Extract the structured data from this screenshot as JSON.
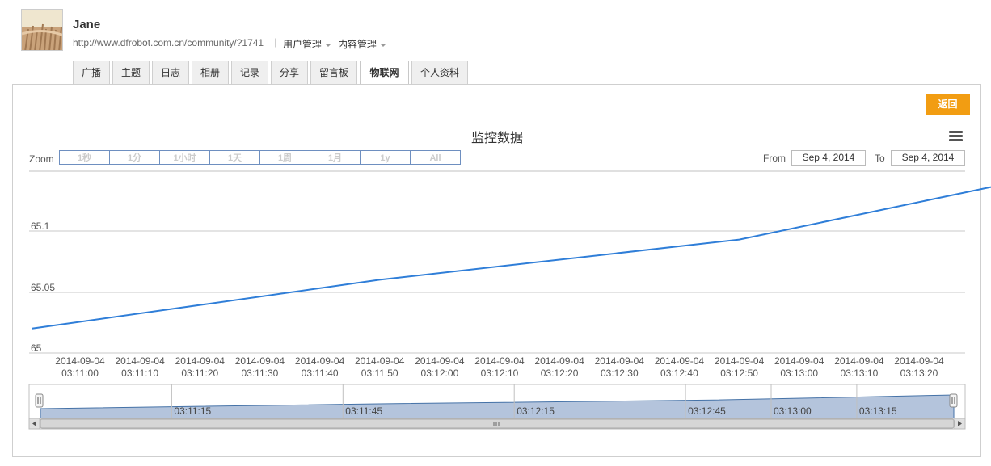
{
  "profile": {
    "name": "Jane",
    "url": "http://www.dfrobot.com.cn/community/?1741",
    "separator": "|",
    "menus": [
      "用户管理",
      "内容管理"
    ]
  },
  "tabs": [
    {
      "label": "广播",
      "active": false
    },
    {
      "label": "主题",
      "active": false
    },
    {
      "label": "日志",
      "active": false
    },
    {
      "label": "相册",
      "active": false
    },
    {
      "label": "记录",
      "active": false
    },
    {
      "label": "分享",
      "active": false
    },
    {
      "label": "留言板",
      "active": false
    },
    {
      "label": "物联网",
      "active": true
    },
    {
      "label": "个人资料",
      "active": false
    }
  ],
  "back_button": "返回",
  "colors": {
    "accent": "#f29d12",
    "line": "#2f7ed8",
    "navigator_fill": "#b4c4dc",
    "zoom_border": "#6e8fc0"
  },
  "toolbar": {
    "menu_icon": "hamburger-icon",
    "zoom_label": "Zoom",
    "zoom_buttons": [
      "1秒",
      "1分",
      "1小时",
      "1天",
      "1周",
      "1月",
      "1y",
      "All"
    ],
    "from_label": "From",
    "from_value": "Sep 4, 2014",
    "to_label": "To",
    "to_value": "Sep 4, 2014"
  },
  "chart_data": {
    "type": "line",
    "title": "监控数据",
    "xlabel": "",
    "ylabel": "",
    "ylim": [
      65,
      65.126
    ],
    "y_ticks": [
      "65",
      "65.05",
      "65.1"
    ],
    "x_ticks": [
      [
        "2014-09-04",
        "03:11:00"
      ],
      [
        "2014-09-04",
        "03:11:10"
      ],
      [
        "2014-09-04",
        "03:11:20"
      ],
      [
        "2014-09-04",
        "03:11:30"
      ],
      [
        "2014-09-04",
        "03:11:40"
      ],
      [
        "2014-09-04",
        "03:11:50"
      ],
      [
        "2014-09-04",
        "03:12:00"
      ],
      [
        "2014-09-04",
        "03:12:10"
      ],
      [
        "2014-09-04",
        "03:12:20"
      ],
      [
        "2014-09-04",
        "03:12:30"
      ],
      [
        "2014-09-04",
        "03:12:40"
      ],
      [
        "2014-09-04",
        "03:12:50"
      ],
      [
        "2014-09-04",
        "03:13:00"
      ],
      [
        "2014-09-04",
        "03:13:10"
      ],
      [
        "2014-09-04",
        "03:13:20"
      ]
    ],
    "points": [
      {
        "x": "2014-09-04 03:10:52",
        "y": 65.02
      },
      {
        "x": "2014-09-04 03:11:50",
        "y": 65.06
      },
      {
        "x": "2014-09-04 03:12:50",
        "y": 65.093
      },
      {
        "x": "2014-09-04 03:13:32",
        "y": 65.136
      }
    ],
    "navigator_labels": [
      "03:11:15",
      "03:11:45",
      "03:12:15",
      "03:12:45",
      "03:13:00",
      "03:13:15"
    ],
    "grid": true,
    "legend": "none"
  }
}
